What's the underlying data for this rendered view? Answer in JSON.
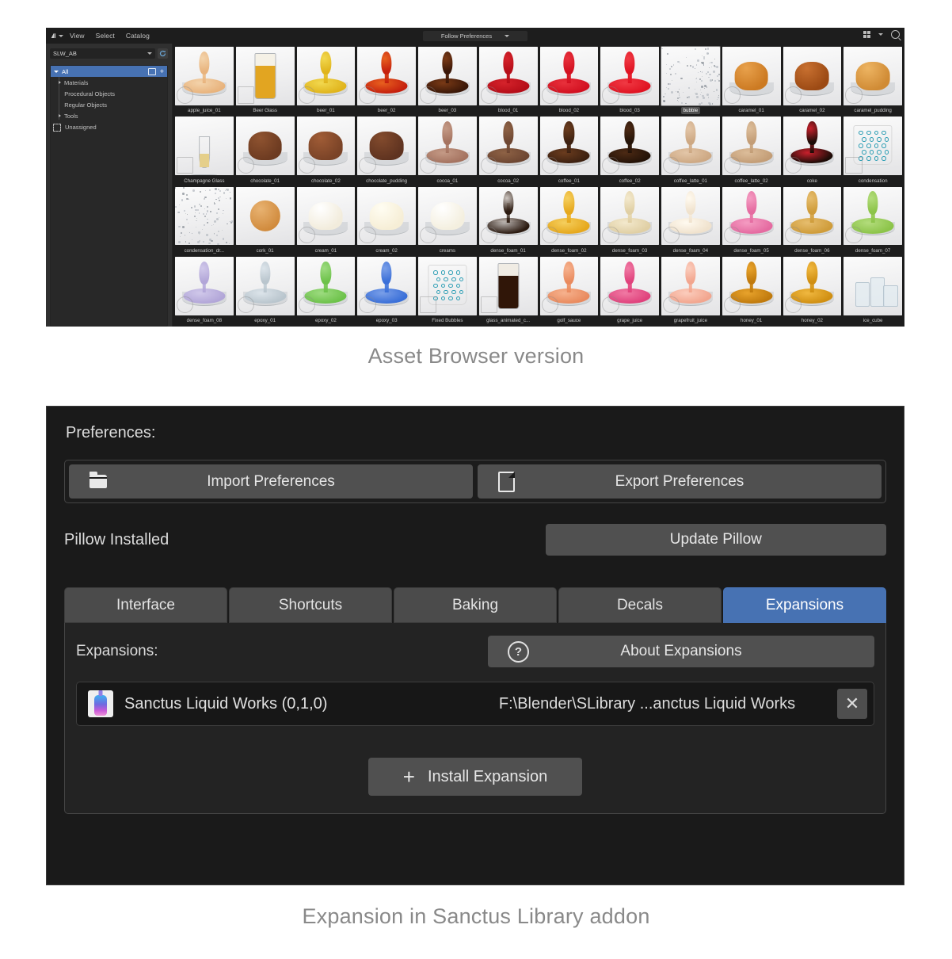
{
  "asset_browser": {
    "menus": [
      "View",
      "Select",
      "Catalog"
    ],
    "library_value": "SLW_AB",
    "display_mode": "Follow Preferences",
    "icons": {
      "editor_type": "asset-browser-editor-icon",
      "refresh": "refresh-icon",
      "display_grid": "display-mode-icon",
      "search": "search-icon",
      "dropdown": "chevron-down-icon"
    },
    "catalog": {
      "root": "All",
      "children": [
        "Materials",
        "Procedural Objects",
        "Regular Objects",
        "Tools"
      ],
      "unassigned": "Unassigned"
    },
    "assets": [
      {
        "label": "apple_juice_01",
        "kind": "pour",
        "color": "#e8b37d",
        "accent": "#f3d3ab"
      },
      {
        "label": "Beer Glass",
        "kind": "glass",
        "color": "#e2a521",
        "accent": "#f5f1e6"
      },
      {
        "label": "beer_01",
        "kind": "pour",
        "color": "#e0b41c",
        "accent": "#f2d84f"
      },
      {
        "label": "beer_02",
        "kind": "pour",
        "color": "#c5200e",
        "accent": "#e8611f"
      },
      {
        "label": "beer_03",
        "kind": "pour",
        "color": "#3a1708",
        "accent": "#7a3a16"
      },
      {
        "label": "blood_01",
        "kind": "pour",
        "color": "#b50d18",
        "accent": "#d5232b"
      },
      {
        "label": "blood_02",
        "kind": "pour",
        "color": "#d21020",
        "accent": "#e8313c"
      },
      {
        "label": "blood_03",
        "kind": "pour",
        "color": "#e01322",
        "accent": "#f03a44"
      },
      {
        "label": "bubble",
        "kind": "specks",
        "color": "#c9cdd2",
        "accent": "#ffffff",
        "selected": true
      },
      {
        "label": "caramel_01",
        "kind": "swirl",
        "color": "#cc7a22",
        "accent": "#e8a14c"
      },
      {
        "label": "caramel_02",
        "kind": "swirl",
        "color": "#9c4a14",
        "accent": "#c87030"
      },
      {
        "label": "caramel_pudding",
        "kind": "swirl",
        "color": "#d08b35",
        "accent": "#edb462"
      },
      {
        "label": "Champagne Glass",
        "kind": "flute",
        "color": "#e5cf8a",
        "accent": "#f7f3e2"
      },
      {
        "label": "chocolate_01",
        "kind": "swirl",
        "color": "#6d3b21",
        "accent": "#8f5330"
      },
      {
        "label": "chocolate_02",
        "kind": "swirl",
        "color": "#7a4327",
        "accent": "#a05c36"
      },
      {
        "label": "chocolate_pudding",
        "kind": "swirl",
        "color": "#5f3320",
        "accent": "#834b2d"
      },
      {
        "label": "cocoa_01",
        "kind": "pour",
        "color": "#a57360",
        "accent": "#c49a86"
      },
      {
        "label": "cocoa_02",
        "kind": "pour",
        "color": "#6d4632",
        "accent": "#8e6245"
      },
      {
        "label": "coffee_01",
        "kind": "pour",
        "color": "#3d2111",
        "accent": "#6b3c1e"
      },
      {
        "label": "coffee_02",
        "kind": "pour",
        "color": "#241308",
        "accent": "#4d2a14"
      },
      {
        "label": "coffee_latte_01",
        "kind": "pour",
        "color": "#cda883",
        "accent": "#e3c6a8"
      },
      {
        "label": "coffee_latte_02",
        "kind": "pour",
        "color": "#c39d76",
        "accent": "#dcbd9a"
      },
      {
        "label": "coke",
        "kind": "pour",
        "color": "#1d0c07",
        "accent": "#c8202c"
      },
      {
        "label": "condensation",
        "kind": "cup",
        "color": "#2f9fb5",
        "accent": "#d8d8d8"
      },
      {
        "label": "condensation_dr...",
        "kind": "specks",
        "color": "#cfd4d9",
        "accent": "#ffffff"
      },
      {
        "label": "cork_01",
        "kind": "sphere",
        "color": "#d08a3c",
        "accent": "#e8b271"
      },
      {
        "label": "cream_01",
        "kind": "swirl",
        "color": "#f2ecdc",
        "accent": "#ffffff"
      },
      {
        "label": "cream_02",
        "kind": "swirl",
        "color": "#f6eed6",
        "accent": "#fffdf2"
      },
      {
        "label": "creams",
        "kind": "swirl",
        "color": "#f4efdf",
        "accent": "#ffffff"
      },
      {
        "label": "dense_foam_01",
        "kind": "pour",
        "color": "#2b1a10",
        "accent": "#55372140"
      },
      {
        "label": "dense_foam_02",
        "kind": "pour",
        "color": "#e6a81d",
        "accent": "#f5cf5e"
      },
      {
        "label": "dense_foam_03",
        "kind": "pour",
        "color": "#e0cfa4",
        "accent": "#f3e9cd"
      },
      {
        "label": "dense_foam_04",
        "kind": "pour",
        "color": "#f0e2cd",
        "accent": "#fffaf0"
      },
      {
        "label": "dense_foam_05",
        "kind": "pour",
        "color": "#e56aa0",
        "accent": "#f49cc2"
      },
      {
        "label": "dense_foam_06",
        "kind": "pour",
        "color": "#cf9c3a",
        "accent": "#e6bd6e"
      },
      {
        "label": "dense_foam_07",
        "kind": "pour",
        "color": "#8cc449",
        "accent": "#b3dc7c"
      },
      {
        "label": "dense_foam_08",
        "kind": "pour",
        "color": "#b2a6d8",
        "accent": "#d0c8ea"
      },
      {
        "label": "epoxy_01",
        "kind": "pour",
        "color": "#b9c5cd",
        "accent": "#dce4ea"
      },
      {
        "label": "epoxy_02",
        "kind": "pour",
        "color": "#6dc24a",
        "accent": "#9ddb80"
      },
      {
        "label": "epoxy_03",
        "kind": "pour",
        "color": "#3a6fd8",
        "accent": "#7a9fe8"
      },
      {
        "label": "Fixed Bubbles",
        "kind": "cup",
        "color": "#2f9fb5",
        "accent": "#cfcfcf"
      },
      {
        "label": "glass_animated_c...",
        "kind": "glass",
        "color": "#301608",
        "accent": "#f0ece4"
      },
      {
        "label": "golf_sauce",
        "kind": "pour",
        "color": "#e98a5e",
        "accent": "#f6b28e"
      },
      {
        "label": "grape_juice",
        "kind": "pour",
        "color": "#e0427c",
        "accent": "#f07aa4"
      },
      {
        "label": "grapefruit_juice",
        "kind": "pour",
        "color": "#f2a58e",
        "accent": "#fbcdbd"
      },
      {
        "label": "honey_01",
        "kind": "pour",
        "color": "#c07a0d",
        "accent": "#e8a32c"
      },
      {
        "label": "honey_02",
        "kind": "pour",
        "color": "#d08f12",
        "accent": "#f0b840"
      },
      {
        "label": "ice_cube",
        "kind": "ice",
        "color": "#dbe7ee",
        "accent": "#ffffff"
      },
      {
        "label": "",
        "kind": "glass",
        "color": "#e6dcc4",
        "accent": "#f2efe6"
      },
      {
        "label": "",
        "kind": "plain",
        "color": "#efefef",
        "accent": "#ffffff"
      },
      {
        "label": "",
        "kind": "sphere",
        "color": "#8cc43a",
        "accent": "#b7dc77"
      },
      {
        "label": "",
        "kind": "sphere",
        "color": "#efe7ca",
        "accent": "#fbf6e6"
      },
      {
        "label": "",
        "kind": "sphere",
        "color": "#4a4a4a",
        "accent": "#8b8b8b"
      },
      {
        "label": "",
        "kind": "sphere",
        "color": "#6cb8ea",
        "accent": "#a3d5f3"
      },
      {
        "label": "",
        "kind": "sphere",
        "color": "#d8cfa8",
        "accent": "#ebe6cc"
      },
      {
        "label": "",
        "kind": "sphere",
        "color": "#a8a8a8",
        "accent": "#cfcfcf"
      },
      {
        "label": "",
        "kind": "sphere",
        "color": "#e8e080",
        "accent": "#f3efb6"
      },
      {
        "label": "",
        "kind": "sphere",
        "color": "#e26ad0",
        "accent": "#f09ce0"
      },
      {
        "label": "",
        "kind": "sphere",
        "color": "#7ec44a",
        "accent": "#a9dc80"
      },
      {
        "label": "",
        "kind": "sphere",
        "color": "#8fd3e8",
        "accent": "#bee6f3"
      }
    ]
  },
  "caption_top": "Asset Browser version",
  "caption_bottom": "Expansion in Sanctus Library addon",
  "preferences": {
    "title": "Preferences:",
    "import_label": "Import Preferences",
    "export_label": "Export Preferences",
    "import_icon": "folder-icon",
    "export_icon": "file-export-icon",
    "pillow_status": "Pillow Installed",
    "pillow_button": "Update Pillow",
    "tabs": [
      {
        "label": "Interface",
        "active": false
      },
      {
        "label": "Shortcuts",
        "active": false
      },
      {
        "label": "Baking",
        "active": false
      },
      {
        "label": "Decals",
        "active": false
      },
      {
        "label": "Expansions",
        "active": true
      }
    ],
    "expansions_panel": {
      "heading": "Expansions:",
      "about_button": "About Expansions",
      "about_icon": "question-mark-icon",
      "close_icon": "close-icon",
      "items": [
        {
          "name": "Sanctus Liquid Works (0,1,0)",
          "path": "F:\\Blender\\SLibrary ...anctus Liquid Works",
          "thumb_icon": "liquid-bottle-icon"
        }
      ],
      "install_button": "Install Expansion",
      "install_icon": "plus-icon"
    },
    "accent_color": "#4772b3",
    "panel_bg": "#1a1a1a",
    "button_bg": "#505050"
  }
}
